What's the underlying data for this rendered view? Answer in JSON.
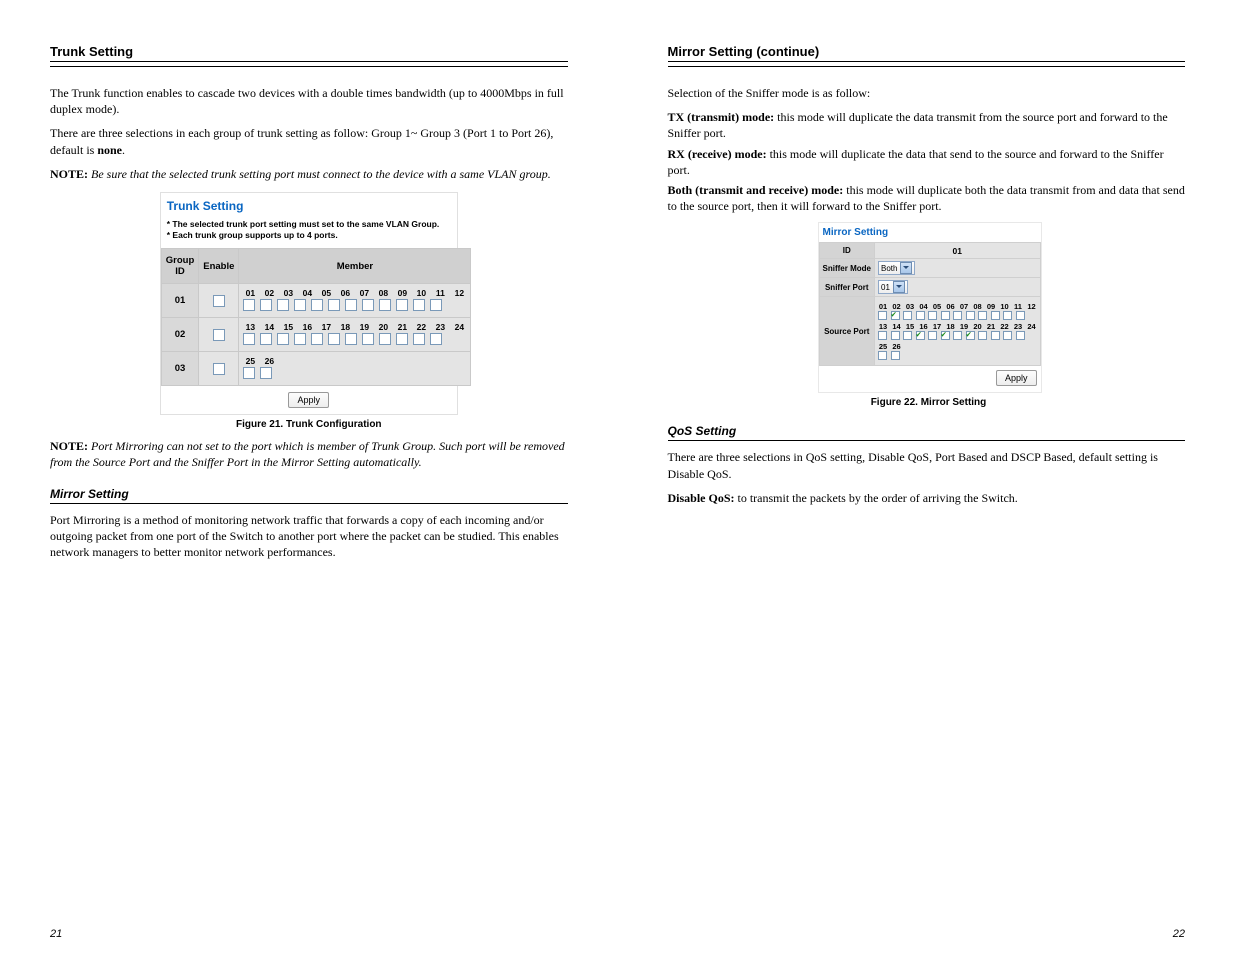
{
  "left": {
    "heading": "Trunk Setting",
    "para1": "The Trunk function enables to cascade two devices with a double times bandwidth (up to 4000Mbps in full duplex mode).",
    "para2_a": "There are three selections in each group of trunk setting as follow: Group 1~ Group 3 (Port 1 to Port 26), default is ",
    "para2_b": "none",
    "para2_c": ".",
    "note1": "Be sure that the selected trunk setting port must connect to the device with a same VLAN group.",
    "panel": {
      "title": "Trunk Setting",
      "note_a": "* The selected trunk port setting must set to the same VLAN Group.",
      "note_b": "* Each trunk group supports up to 4 ports.",
      "th_group": "Group ID",
      "th_enable": "Enable",
      "th_member": "Member",
      "rows": [
        {
          "id": "01",
          "ports": [
            "01",
            "02",
            "03",
            "04",
            "05",
            "06",
            "07",
            "08",
            "09",
            "10",
            "11",
            "12"
          ]
        },
        {
          "id": "02",
          "ports": [
            "13",
            "14",
            "15",
            "16",
            "17",
            "18",
            "19",
            "20",
            "21",
            "22",
            "23",
            "24"
          ]
        },
        {
          "id": "03",
          "ports": [
            "25",
            "26"
          ]
        }
      ],
      "apply": "Apply"
    },
    "fig_caption": "Figure 21. Trunk Configuration",
    "mirror_heading": "Mirror Setting",
    "mirror_p1": "Port Mirroring is a method of monitoring network traffic that forwards a copy of each incoming and/or outgoing packet from one port of the Switch to another port where the packet can be studied. This enables network managers to better monitor network performances.",
    "note2": "Port Mirroring can not set to the port which is member of Trunk Group. Such port will be removed from the Source Port and the Sniffer Port in the Mirror Setting automatically.",
    "pagenum": "21"
  },
  "right": {
    "heading": "Mirror Setting (continue)",
    "para": "Selection of the Sniffer mode is as follow:",
    "def_tx_a": "TX (transmit) mode:",
    "def_tx_b": " this mode will duplicate the data transmit from the source port and forward to the Sniffer port.",
    "def_rx_a": "RX (receive) mode:",
    "def_rx_b": " this mode will duplicate the data that send to the source and forward to the Sniffer port.",
    "def_both_a": "Both (transmit and receive) mode:",
    "def_both_b": " this mode will duplicate both the data transmit from and data that send to the source port, then it will forward to the Sniffer port.",
    "panel": {
      "title": "Mirror Setting",
      "th_id": "ID",
      "id_val": "01",
      "th_mode": "Sniffer Mode",
      "mode_val": "Both",
      "th_port": "Sniffer Port",
      "port_val": "01",
      "th_source": "Source Port",
      "rowA": [
        "01",
        "02",
        "03",
        "04",
        "05",
        "06",
        "07",
        "08",
        "09",
        "10",
        "11",
        "12"
      ],
      "chkA": [
        false,
        true,
        false,
        false,
        false,
        false,
        false,
        false,
        false,
        false,
        false,
        false
      ],
      "rowB": [
        "13",
        "14",
        "15",
        "16",
        "17",
        "18",
        "19",
        "20",
        "21",
        "22",
        "23",
        "24"
      ],
      "chkB": [
        false,
        false,
        false,
        true,
        false,
        true,
        false,
        true,
        false,
        false,
        false,
        false
      ],
      "rowC": [
        "25",
        "26"
      ],
      "chkC": [
        false,
        false
      ],
      "apply": "Apply"
    },
    "fig_caption": "Figure 22. Mirror Setting",
    "qos_heading": "QoS Setting",
    "qos_p1": "There are three selections in QoS setting, Disable QoS, Port Based and DSCP Based, default setting is Disable QoS.",
    "qos_p2_a": "Disable QoS:",
    "qos_p2_b": " to transmit the packets by the order of arriving the Switch.",
    "pagenum": "22"
  }
}
